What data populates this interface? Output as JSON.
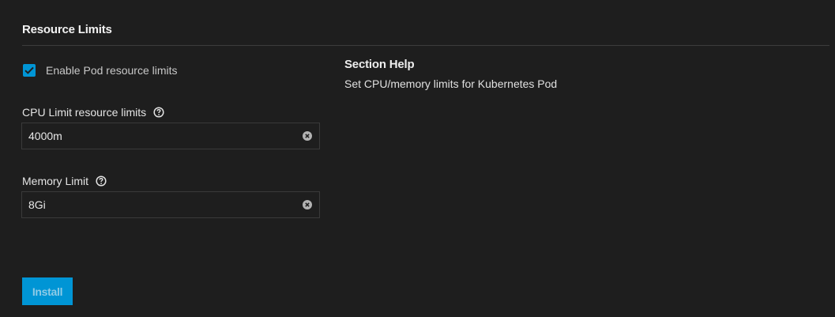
{
  "section": {
    "title": "Resource Limits"
  },
  "enable_limits": {
    "label": "Enable Pod resource limits",
    "checked": true
  },
  "cpu_limit": {
    "label": "CPU Limit resource limits",
    "value": "4000m"
  },
  "memory_limit": {
    "label": "Memory Limit",
    "value": "8Gi"
  },
  "help": {
    "title": "Section Help",
    "text": "Set CPU/memory limits for Kubernetes Pod"
  },
  "actions": {
    "install_label": "Install"
  },
  "icons": {
    "checkbox": "check-icon",
    "help": "help-circle-icon",
    "clear": "clear-circle-icon"
  },
  "colors": {
    "background": "#1e1e1e",
    "accent": "#0095d5",
    "divider": "#3c3c3c",
    "input_border": "#3a3a3a"
  }
}
